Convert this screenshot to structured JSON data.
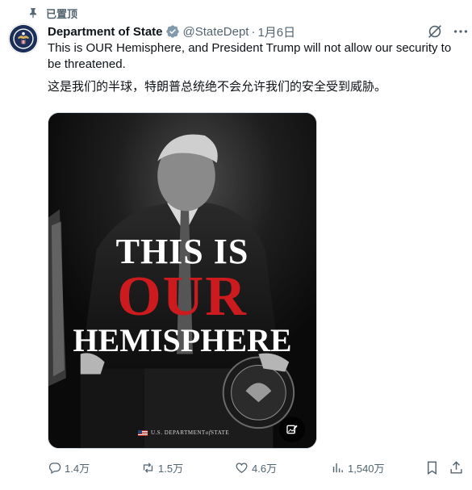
{
  "pinned": {
    "label": "已置顶"
  },
  "tweet": {
    "author_name": "Department of State",
    "handle": "@StateDept",
    "separator": "·",
    "date": "1月6日",
    "text_en": "This is OUR Hemisphere, and President Trump will not allow our security to be threatened.",
    "text_zh": "这是我们的半球，特朗普总统绝不会允许我们的安全受到威胁。"
  },
  "media": {
    "headline_line1": "THIS IS",
    "headline_line2": "OUR",
    "headline_line3": "HEMISPHERE",
    "brand_prefix": "U.S. DEPARTMENT ",
    "brand_of": "of",
    "brand_suffix": " STATE",
    "accent_red": "#cc1b1e"
  },
  "actions": {
    "replies": "1.4万",
    "retweets": "1.5万",
    "likes": "4.6万",
    "views": "1,540万"
  },
  "colors": {
    "verified_blue": "#829aab",
    "secondary_text": "#536471"
  }
}
